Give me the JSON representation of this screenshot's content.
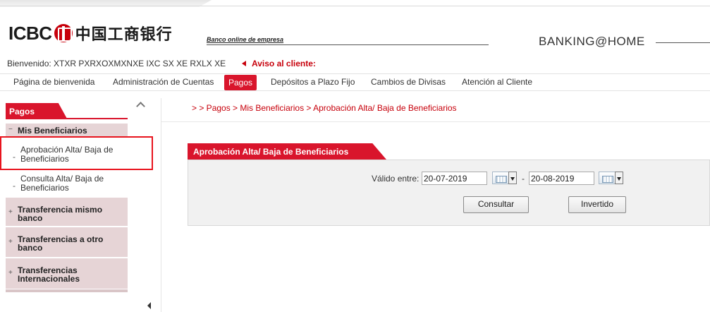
{
  "header": {
    "logo_text": "ICBC",
    "logo_cn": "中国工商银行",
    "tagline": "Banco online de empresa",
    "brand": "BANKING@HOME"
  },
  "welcome": {
    "greeting": "Bienvenido: XTXR PXRXOXMXNXE IXC SX XE RXLX XE",
    "notice": "Aviso al cliente:"
  },
  "menu": {
    "items": [
      {
        "label": "Página de bienvenida"
      },
      {
        "label": "Administración de Cuentas"
      },
      {
        "label": "Pagos"
      },
      {
        "label": "Depósitos a Plazo Fijo"
      },
      {
        "label": "Cambios de Divisas"
      },
      {
        "label": "Atención al Cliente"
      }
    ],
    "active": "Pagos"
  },
  "sidebar": {
    "title": "Pagos",
    "groups": [
      {
        "label": "Mis Beneficiarios",
        "expanded": true,
        "items": [
          {
            "label": "Aprobación Alta/ Baja de Beneficiarios"
          },
          {
            "label": "Consulta Alta/ Baja de Beneficiarios"
          }
        ]
      },
      {
        "label": "Transferencia mismo banco",
        "expanded": false
      },
      {
        "label": "Transferencias a otro banco",
        "expanded": false
      },
      {
        "label": "Transferencias Internacionales",
        "expanded": false
      }
    ]
  },
  "breadcrumb": "> > Pagos > Mis Beneficiarios > Aprobación Alta/ Baja de Beneficiarios",
  "panel": {
    "title": "Aprobación Alta/ Baja de Beneficiarios",
    "date_label": "Válido entre:",
    "date_from": "20-07-2019",
    "date_to": "20-08-2019",
    "range_sep": "-",
    "consult_label": "Consultar",
    "invert_label": "Invertido"
  },
  "colors": {
    "accent": "#d9152c",
    "sidebar_group_bg": "#e6d4d6",
    "highlight": "#e8141e"
  }
}
